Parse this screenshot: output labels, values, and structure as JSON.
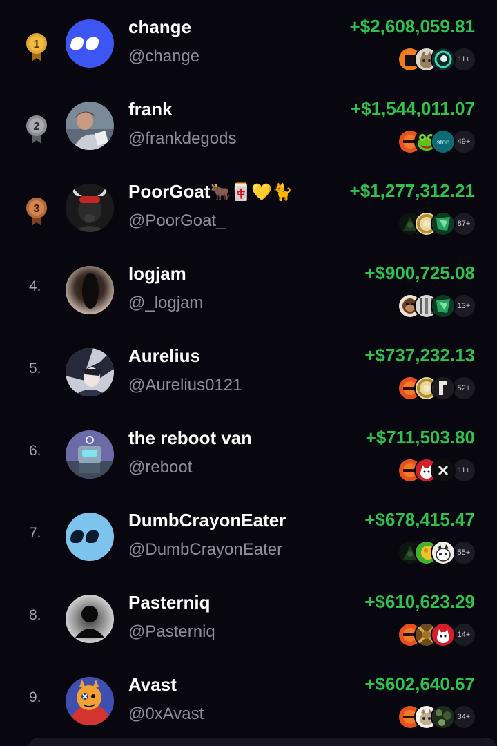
{
  "colors": {
    "positive": "#2fc24d",
    "gold": "#d39a2f",
    "silver": "#9b9ba3",
    "bronze": "#b0683a"
  },
  "rows": [
    {
      "rank": "1",
      "medal": "gold",
      "name": "change",
      "handle": "@change",
      "pnl": "+$2,608,059.81",
      "more": "11+",
      "avatar": "logo-blue",
      "tokens": [
        "orange-black",
        "cat",
        "teal-ring"
      ]
    },
    {
      "rank": "2",
      "medal": "silver",
      "name": "frank",
      "handle": "@frankdegods",
      "pnl": "+$1,544,011.07",
      "more": "49+",
      "avatar": "photo-person",
      "tokens": [
        "orange-text",
        "green-frog",
        "teal-ston"
      ]
    },
    {
      "rank": "3",
      "medal": "bronze",
      "name": "PoorGoat",
      "name_emoji": "🐂🀄💛🐈",
      "handle": "@PoorGoat_",
      "pnl": "+$1,277,312.21",
      "more": "87+",
      "avatar": "goat",
      "tokens": [
        "dark-green",
        "gold-coin",
        "green-jade"
      ]
    },
    {
      "rank": "4.",
      "name": "logjam",
      "handle": "@_logjam",
      "pnl": "+$900,725.08",
      "more": "13+",
      "avatar": "blur",
      "tokens": [
        "monkey",
        "grey-pattern",
        "green-jade"
      ]
    },
    {
      "rank": "5.",
      "name": "Aurelius",
      "handle": "@Aurelius0121",
      "pnl": "+$737,232.13",
      "more": "52+",
      "avatar": "anime",
      "tokens": [
        "orange-text",
        "gold-coin",
        "white-shape"
      ]
    },
    {
      "rank": "6.",
      "name": "the reboot van",
      "handle": "@reboot",
      "pnl": "+$711,503.80",
      "more": "11+",
      "avatar": "robot",
      "tokens": [
        "orange-text",
        "red-dog",
        "black-x"
      ]
    },
    {
      "rank": "7.",
      "name": "DumbCrayonEater",
      "handle": "@DumbCrayonEater",
      "pnl": "+$678,415.47",
      "more": "55+",
      "avatar": "logo-light",
      "tokens": [
        "dark-green",
        "green-yellow",
        "white-cat"
      ]
    },
    {
      "rank": "8.",
      "name": "Pasterniq",
      "handle": "@Pasterniq",
      "pnl": "+$610,623.29",
      "more": "14+",
      "avatar": "silhouette",
      "tokens": [
        "orange-text",
        "brown-pattern",
        "red-dog"
      ]
    },
    {
      "rank": "9.",
      "name": "Avast",
      "handle": "@0xAvast",
      "pnl": "+$602,640.67",
      "more": "34+",
      "avatar": "orange-char",
      "tokens": [
        "orange-text",
        "white-cat",
        "green-dark-pattern"
      ]
    }
  ]
}
